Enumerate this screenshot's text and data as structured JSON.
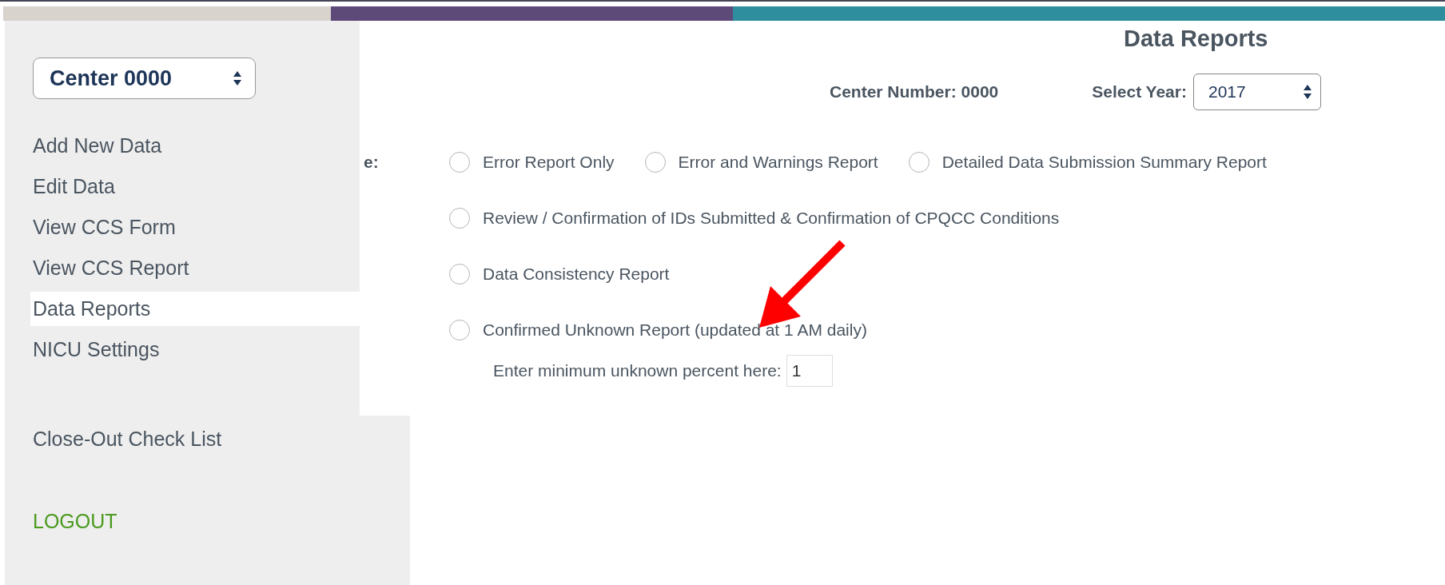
{
  "sidebar": {
    "center_select": {
      "value": "Center 0000"
    },
    "items": [
      {
        "label": "Add New Data",
        "selected": false
      },
      {
        "label": "Edit Data",
        "selected": false
      },
      {
        "label": "View CCS Form",
        "selected": false
      },
      {
        "label": "View CCS Report",
        "selected": false
      },
      {
        "label": "Data Reports",
        "selected": true
      },
      {
        "label": "NICU Settings",
        "selected": false
      }
    ],
    "lower_items": [
      {
        "label": "Close-Out Check List",
        "selected": false
      }
    ],
    "logout": "LOGOUT"
  },
  "main": {
    "title": "Data Reports",
    "center_number": "Center Number: 0000",
    "year_label": "Select Year:",
    "year_select": {
      "value": "2017"
    },
    "report_type_label": "e:",
    "report_rows": [
      {
        "options": [
          {
            "label": "Error Report Only",
            "selected": false
          },
          {
            "label": "Error and Warnings Report",
            "selected": false
          },
          {
            "label": "Detailed Data Submission Summary Report",
            "selected": false
          }
        ]
      },
      {
        "options": [
          {
            "label": "Review / Confirmation of IDs Submitted & Confirmation of CPQCC Conditions",
            "selected": false
          }
        ]
      },
      {
        "options": [
          {
            "label": "Data Consistency Report",
            "selected": false
          }
        ]
      },
      {
        "options": [
          {
            "label": "Confirmed Unknown Report (updated at 1 AM daily)",
            "selected": false
          }
        ]
      }
    ],
    "min_percent": {
      "label": "Enter minimum unknown percent here:",
      "value": "1"
    }
  }
}
